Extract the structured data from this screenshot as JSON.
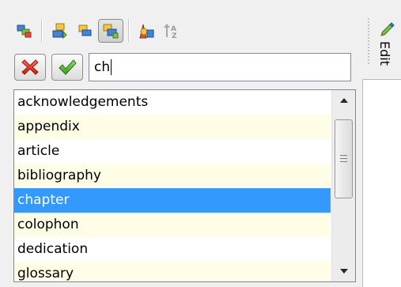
{
  "toolbar": {
    "buttons": [
      {
        "icon": "element-replace-icon"
      },
      {
        "icon": "insert-before-icon"
      },
      {
        "icon": "insert-element-icon"
      },
      {
        "icon": "append-child-icon",
        "active": true
      },
      {
        "icon": "change-element-icon"
      },
      {
        "icon": "sort-icon"
      }
    ]
  },
  "filter": {
    "cancel_icon": "close-icon",
    "ok_icon": "check-icon",
    "value": "ch"
  },
  "list": {
    "items": [
      "acknowledgements",
      "appendix",
      "article",
      "bibliography",
      "chapter",
      "colophon",
      "dedication",
      "glossary"
    ],
    "selected_index": 4
  },
  "side_tab": {
    "label": "Edit",
    "icon": "pencil-icon"
  },
  "colors": {
    "selection": "#3399ff",
    "alt_row": "#fffde6"
  }
}
